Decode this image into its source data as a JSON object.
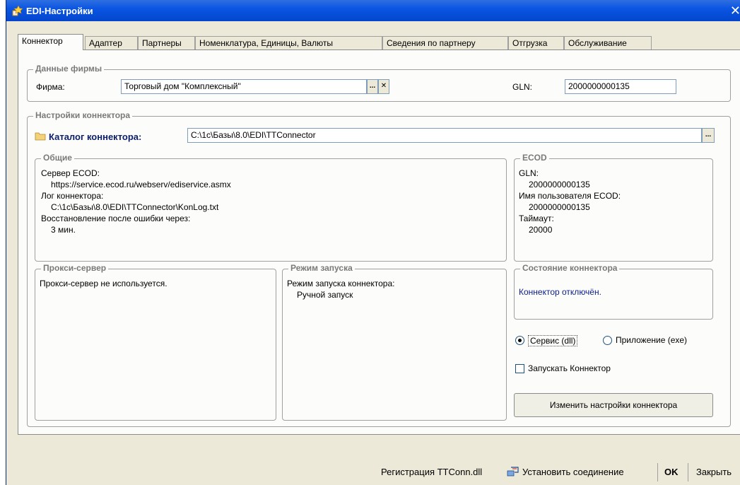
{
  "window": {
    "title": "EDI-Настройки",
    "close": "✕"
  },
  "tabs": [
    {
      "label": "Коннектор"
    },
    {
      "label": "Адаптер"
    },
    {
      "label": "Партнеры"
    },
    {
      "label": "Номенклатура, Единицы, Валюты"
    },
    {
      "label": "Сведения по партнеру"
    },
    {
      "label": "Отгрузка"
    },
    {
      "label": "Обслуживание"
    }
  ],
  "firm": {
    "group_title": "Данные фирмы",
    "firm_label": "Фирма:",
    "firm_value": "Торговый дом \"Комплексный\"",
    "ellipsis": "...",
    "clear": "✕",
    "gln_label": "GLN:",
    "gln_value": "2000000000135"
  },
  "connector": {
    "group_title": "Настройки коннектора",
    "catalog_label": "Каталог коннектора:",
    "catalog_value": "C:\\1c\\Базы\\8.0\\EDI\\TTConnector",
    "ellipsis": "..."
  },
  "general": {
    "group_title": "Общие",
    "server_label": "Сервер ECOD:",
    "server_value": "https://service.ecod.ru/webserv/ediservice.asmx",
    "log_label": "Лог коннектора:",
    "log_value": "C:\\1c\\Базы\\8.0\\EDI\\TTConnector\\KonLog.txt",
    "recovery_label": "Восстановление после ошибки через:",
    "recovery_value": "3 мин."
  },
  "ecod": {
    "group_title": "ECOD",
    "gln_label": "GLN:",
    "gln_value": "2000000000135",
    "user_label": "Имя пользователя ECOD:",
    "user_value": "2000000000135",
    "timeout_label": "Таймаут:",
    "timeout_value": "20000"
  },
  "proxy": {
    "group_title": "Прокси-сервер",
    "text": "Прокси-сервер не используется."
  },
  "launch": {
    "group_title": "Режим запуска",
    "label": "Режим запуска коннектора:",
    "value": "Ручной запуск"
  },
  "state": {
    "group_title": "Состояние коннектора",
    "text": "Коннектор отключён.",
    "text_color": "#0a1e8c"
  },
  "options": {
    "service_label": "Сервис (dll)",
    "app_label": "Приложение (exe)",
    "selected": "service",
    "run_label": "Запускать Коннектор",
    "run_checked": false,
    "change_button": "Изменить настройки коннектора"
  },
  "bottom": {
    "register": "Регистрация TTConn.dll",
    "connect": "Установить соединение",
    "ok": "OK",
    "close": "Закрыть"
  },
  "colors": {
    "title_bar": "#0a55e3",
    "group_title": "#7a7a7a",
    "catalog_label": "#0a1e6a"
  }
}
